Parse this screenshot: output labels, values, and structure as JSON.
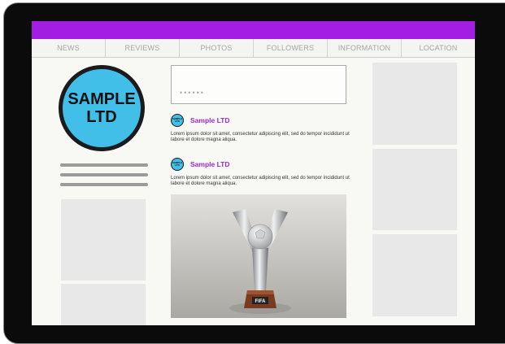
{
  "nav": {
    "tabs": [
      "NEWS",
      "REVIEWS",
      "PHOTOS",
      "FOLLOWERS",
      "INFORMATION",
      "LOCATION"
    ]
  },
  "logo": {
    "line1": "SAMPLE",
    "line2": "LTD"
  },
  "search": {
    "value": "••••••"
  },
  "posts": [
    {
      "avatar_line1": "SAMPLE",
      "avatar_line2": "LTD",
      "name": "Sample LTD",
      "text": "Lorem ipsum dolor sit amet, consectetur adipiscing elit, sed do tempor incididunt ut labore et dolore magna aliqua."
    },
    {
      "avatar_line1": "SAMPLE",
      "avatar_line2": "LTD",
      "name": "Sample LTD",
      "text": "Lorem ipsum dolor sit amet, consectetur adipiscing elit, sed do tempor incididunt ut labore et dolore magna aliqua."
    }
  ],
  "photo": {
    "trophy_label": "FIFA"
  },
  "colors": {
    "accent": "#a21ee3",
    "logo_blue": "#41bfe9",
    "name_purple": "#9c2ad6"
  }
}
